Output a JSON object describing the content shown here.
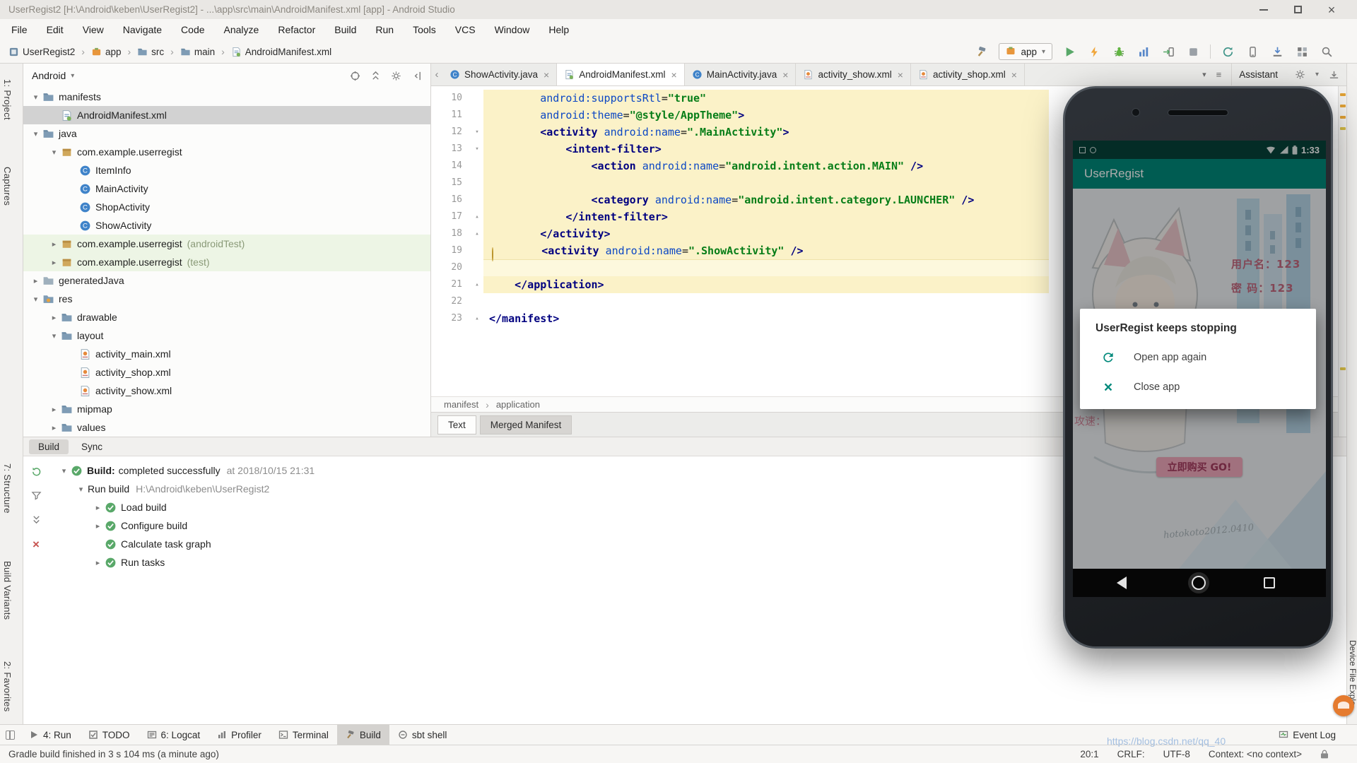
{
  "window": {
    "title": "UserRegist2 [H:\\Android\\keben\\UserRegist2] - ...\\app\\src\\main\\AndroidManifest.xml [app] - Android Studio"
  },
  "menu": {
    "items": [
      "File",
      "Edit",
      "View",
      "Navigate",
      "Code",
      "Analyze",
      "Refactor",
      "Build",
      "Run",
      "Tools",
      "VCS",
      "Window",
      "Help"
    ]
  },
  "breadcrumbs": {
    "items": [
      {
        "label": "UserRegist2",
        "icon": "project"
      },
      {
        "label": "app",
        "icon": "module"
      },
      {
        "label": "src",
        "icon": "folder"
      },
      {
        "label": "main",
        "icon": "folder"
      },
      {
        "label": "AndroidManifest.xml",
        "icon": "manifest"
      }
    ]
  },
  "run_toolbar": {
    "config_label": "app"
  },
  "tool_strips": {
    "left_top": [
      "1: Project",
      "Captures"
    ],
    "left_middle": [
      "7: Structure",
      "Build Variants"
    ],
    "left_bottom": [
      "2: Favorites"
    ],
    "right": [
      "Device File Explo"
    ]
  },
  "project_panel": {
    "selector": "Android",
    "tree": [
      {
        "level": 0,
        "chev": "v",
        "icon": "folder",
        "label": "manifests"
      },
      {
        "level": 1,
        "chev": "",
        "icon": "manifest",
        "label": "AndroidManifest.xml",
        "selected": true
      },
      {
        "level": 0,
        "chev": "v",
        "icon": "folder",
        "label": "java"
      },
      {
        "level": 1,
        "chev": "v",
        "icon": "package",
        "label": "com.example.userregist"
      },
      {
        "level": 2,
        "chev": "",
        "icon": "class",
        "label": "ItemInfo"
      },
      {
        "level": 2,
        "chev": "",
        "icon": "class",
        "label": "MainActivity"
      },
      {
        "level": 2,
        "chev": "",
        "icon": "class",
        "label": "ShopActivity"
      },
      {
        "level": 2,
        "chev": "",
        "icon": "class",
        "label": "ShowActivity"
      },
      {
        "level": 1,
        "chev": ">",
        "icon": "package",
        "label": "com.example.userregist",
        "suffix": "(androidTest)",
        "tint": true
      },
      {
        "level": 1,
        "chev": ">",
        "icon": "package",
        "label": "com.example.userregist",
        "suffix": "(test)",
        "tint": true
      },
      {
        "level": 0,
        "chev": ">",
        "icon": "foldergen",
        "label": "generatedJava"
      },
      {
        "level": 0,
        "chev": "v",
        "icon": "folderres",
        "label": "res"
      },
      {
        "level": 1,
        "chev": ">",
        "icon": "folder",
        "label": "drawable"
      },
      {
        "level": 1,
        "chev": "v",
        "icon": "folder",
        "label": "layout"
      },
      {
        "level": 2,
        "chev": "",
        "icon": "xml",
        "label": "activity_main.xml"
      },
      {
        "level": 2,
        "chev": "",
        "icon": "xml",
        "label": "activity_shop.xml"
      },
      {
        "level": 2,
        "chev": "",
        "icon": "xml",
        "label": "activity_show.xml"
      },
      {
        "level": 1,
        "chev": ">",
        "icon": "folder",
        "label": "mipmap"
      },
      {
        "level": 1,
        "chev": ">",
        "icon": "folder",
        "label": "values"
      }
    ]
  },
  "editor_tabs": {
    "tabs": [
      {
        "label": "ShowActivity.java",
        "icon": "class"
      },
      {
        "label": "AndroidManifest.xml",
        "icon": "manifest",
        "active": true
      },
      {
        "label": "MainActivity.java",
        "icon": "class"
      },
      {
        "label": "activity_show.xml",
        "icon": "xml"
      },
      {
        "label": "activity_shop.xml",
        "icon": "xml"
      }
    ],
    "assistant": "Assistant"
  },
  "editor": {
    "lines": [
      {
        "n": "10",
        "hl": true,
        "seg": [
          [
            "pl",
            "        "
          ],
          [
            "at",
            "android:supportsRtl"
          ],
          [
            "pl",
            "="
          ],
          [
            "vl",
            "\"true\""
          ]
        ]
      },
      {
        "n": "11",
        "hl": true,
        "seg": [
          [
            "pl",
            "        "
          ],
          [
            "at",
            "android:theme"
          ],
          [
            "pl",
            "="
          ],
          [
            "vl",
            "\"@style/AppTheme\""
          ],
          [
            "tg",
            ">"
          ]
        ]
      },
      {
        "n": "12",
        "hl": true,
        "fold": true,
        "seg": [
          [
            "pl",
            "        "
          ],
          [
            "tg",
            "<activity "
          ],
          [
            "at",
            "android:name"
          ],
          [
            "pl",
            "="
          ],
          [
            "vl",
            "\".MainActivity\""
          ],
          [
            "tg",
            ">"
          ]
        ]
      },
      {
        "n": "13",
        "hl": true,
        "fold": true,
        "seg": [
          [
            "pl",
            "            "
          ],
          [
            "tg",
            "<intent-filter>"
          ]
        ]
      },
      {
        "n": "14",
        "hl": true,
        "seg": [
          [
            "pl",
            "                "
          ],
          [
            "tg",
            "<action "
          ],
          [
            "at",
            "android:name"
          ],
          [
            "pl",
            "="
          ],
          [
            "vl",
            "\"android.intent.action.MAIN\""
          ],
          [
            "tg",
            " />"
          ]
        ]
      },
      {
        "n": "15",
        "hl": true,
        "seg": []
      },
      {
        "n": "16",
        "hl": true,
        "seg": [
          [
            "pl",
            "                "
          ],
          [
            "tg",
            "<category "
          ],
          [
            "at",
            "android:name"
          ],
          [
            "pl",
            "="
          ],
          [
            "vl",
            "\"android.intent.category.LAUNCHER\""
          ],
          [
            "tg",
            " />"
          ]
        ]
      },
      {
        "n": "17",
        "hl": true,
        "foldend": true,
        "seg": [
          [
            "pl",
            "            "
          ],
          [
            "tg",
            "</intent-filter>"
          ]
        ]
      },
      {
        "n": "18",
        "hl": true,
        "foldend": true,
        "seg": [
          [
            "pl",
            "        "
          ],
          [
            "tg",
            "</activity>"
          ]
        ]
      },
      {
        "n": "19",
        "hl": true,
        "bulb": true,
        "seg": [
          [
            "pl",
            "        "
          ],
          [
            "tg",
            "<activity "
          ],
          [
            "at",
            "android:name"
          ],
          [
            "pl",
            "="
          ],
          [
            "vl",
            "\".ShowActivity\""
          ],
          [
            "tg",
            " />"
          ]
        ]
      },
      {
        "n": "20",
        "hl": true,
        "caret": true,
        "seg": []
      },
      {
        "n": "21",
        "hl": true,
        "foldend": true,
        "seg": [
          [
            "pl",
            "    "
          ],
          [
            "tg",
            "</application>"
          ]
        ]
      },
      {
        "n": "22",
        "seg": []
      },
      {
        "n": "23",
        "foldend": true,
        "seg": [
          [
            "tg",
            "</manifest>"
          ]
        ]
      }
    ],
    "breadcrumb": [
      "manifest",
      "application"
    ],
    "view_tabs": [
      "Text",
      "Merged Manifest"
    ]
  },
  "stripe_marks": [
    {
      "t": 10,
      "c": "#e3a336"
    },
    {
      "t": 26,
      "c": "#e3a336"
    },
    {
      "t": 42,
      "c": "#e3a336"
    },
    {
      "t": 58,
      "c": "#d9bf47"
    },
    {
      "t": 398,
      "c": "#d9bf47"
    }
  ],
  "build_panel": {
    "tabs": [
      "Build",
      "Sync"
    ],
    "tree": [
      {
        "level": 0,
        "chev": "v",
        "icon": "ok",
        "bold": "Build:",
        "label": "completed successfully",
        "meta": "at 2018/10/15 21:31"
      },
      {
        "level": 1,
        "chev": "v",
        "icon": "",
        "label": "Run build",
        "meta": "H:\\Android\\keben\\UserRegist2"
      },
      {
        "level": 2,
        "chev": ">",
        "icon": "ok",
        "label": "Load build"
      },
      {
        "level": 2,
        "chev": ">",
        "icon": "ok",
        "label": "Configure build"
      },
      {
        "level": 2,
        "chev": "",
        "icon": "ok",
        "label": "Calculate task graph"
      },
      {
        "level": 2,
        "chev": ">",
        "icon": "ok",
        "label": "Run tasks"
      }
    ]
  },
  "bottom_bar": {
    "left": [
      {
        "label": "4: Run",
        "icon": "run"
      },
      {
        "label": "TODO",
        "icon": "todo"
      },
      {
        "label": "6: Logcat",
        "icon": "logcat"
      },
      {
        "label": "Profiler",
        "icon": "profiler"
      },
      {
        "label": "Terminal",
        "icon": "terminal"
      },
      {
        "label": "Build",
        "icon": "build",
        "active": true
      },
      {
        "label": "sbt shell",
        "icon": "sbt"
      }
    ],
    "right": [
      {
        "label": "Event Log",
        "icon": "eventlog"
      }
    ]
  },
  "status_bar": {
    "message": "Gradle build finished in 3 s 104 ms (a minute ago)",
    "caret": "20:1",
    "line_sep": "CRLF:",
    "encoding": "UTF-8",
    "context": "Context: <no context>"
  },
  "watermark": "https://blog.csdn.net/qq_40",
  "phone": {
    "status_time": "1:33",
    "app_title": "UserRegist",
    "fields": [
      {
        "text": "用户名：123"
      },
      {
        "text": "密 码：123"
      }
    ],
    "side_text": "攻速：",
    "buy_button": "立即购买 GO!",
    "signature": "hotokoto2012.0410",
    "dialog": {
      "title": "UserRegist keeps stopping",
      "actions": [
        {
          "icon": "refresh",
          "label": "Open app again"
        },
        {
          "icon": "close",
          "label": "Close app"
        }
      ]
    }
  },
  "colors": {
    "accent_teal": "#00897b",
    "highlight_yellow": "#fbf2c8",
    "buy_pink": "#f0a9bd",
    "status_green": "#59a869",
    "csdn_orange": "#e57b2f"
  }
}
